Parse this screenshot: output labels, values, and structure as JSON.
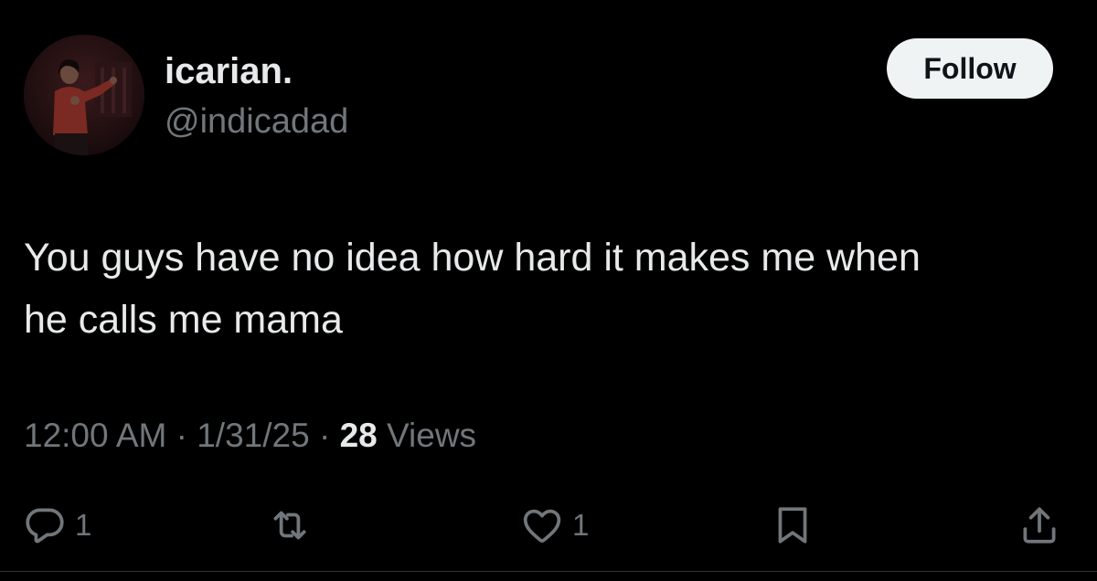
{
  "author": {
    "display_name": "icarian.",
    "handle": "@indicadad",
    "avatar_icon": "profile-photo"
  },
  "follow_label": "Follow",
  "tweet": {
    "text": "You guys have no idea how hard it makes me when\nhe calls me mama",
    "time": "12:00 AM",
    "date": "1/31/25",
    "views_count": "28",
    "views_label": "Views",
    "separator": "·"
  },
  "actions": {
    "reply": {
      "icon": "reply-icon",
      "count": "1"
    },
    "retweet": {
      "icon": "retweet-icon",
      "count": ""
    },
    "like": {
      "icon": "heart-icon",
      "count": "1"
    },
    "bookmark": {
      "icon": "bookmark-icon"
    },
    "share": {
      "icon": "share-icon"
    }
  },
  "colors": {
    "background": "#000000",
    "primary_text": "#e7e9ea",
    "secondary_text": "#71767b",
    "follow_button_bg": "#eff3f4",
    "follow_button_text": "#0f1419"
  }
}
